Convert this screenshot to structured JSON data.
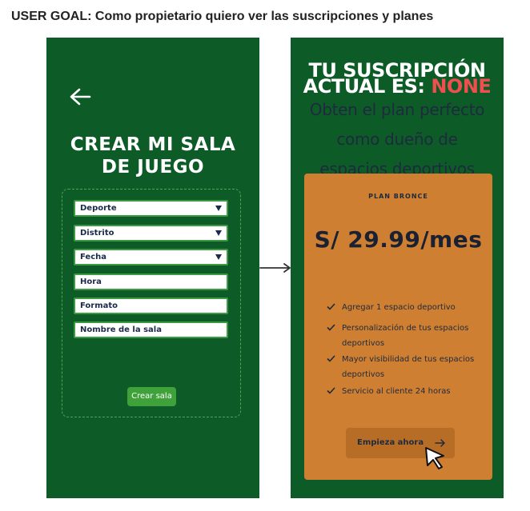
{
  "user_goal": "USER GOAL: Como propietario quiero ver las suscripciones y planes",
  "left_screen": {
    "back_icon": "arrow-left-icon",
    "title_line1": "CREAR MI SALA",
    "title_line2": "DE JUEGO",
    "fields": {
      "deporte": "Deporte",
      "distrito": "Distrito",
      "fecha": "Fecha",
      "hora": "Hora",
      "formato": "Formato",
      "nombre": "Nombre de la sala"
    },
    "submit_label": "Crear sala"
  },
  "right_screen": {
    "subscription_line1": "TU SUSCRIPCIÓN",
    "subscription_line2_prefix": "ACTUAL ES: ",
    "subscription_status": "NONE",
    "pitch_line1": "Obten el plan perfecto",
    "pitch_line2": "como dueño de",
    "pitch_line3": "espacios deportivos",
    "plan": {
      "name": "PLAN BRONCE",
      "price": "S/ 29.99/mes",
      "features": [
        {
          "line1": "Agregar 1 espacio deportivo",
          "line2": ""
        },
        {
          "line1": "Personalización de tus espacios",
          "line2": "deportivos"
        },
        {
          "line1": "Mayor visibilidad de tus espacios",
          "line2": "deportivos"
        },
        {
          "line1": "Servicio al cliente 24 horas",
          "line2": ""
        }
      ],
      "cta_label": "Empieza ahora"
    }
  },
  "colors": {
    "screen_bg": "#0d5c28",
    "accent_green": "#3fa13a",
    "card_orange": "#cf7f31",
    "status_red": "#ef4f4f"
  }
}
